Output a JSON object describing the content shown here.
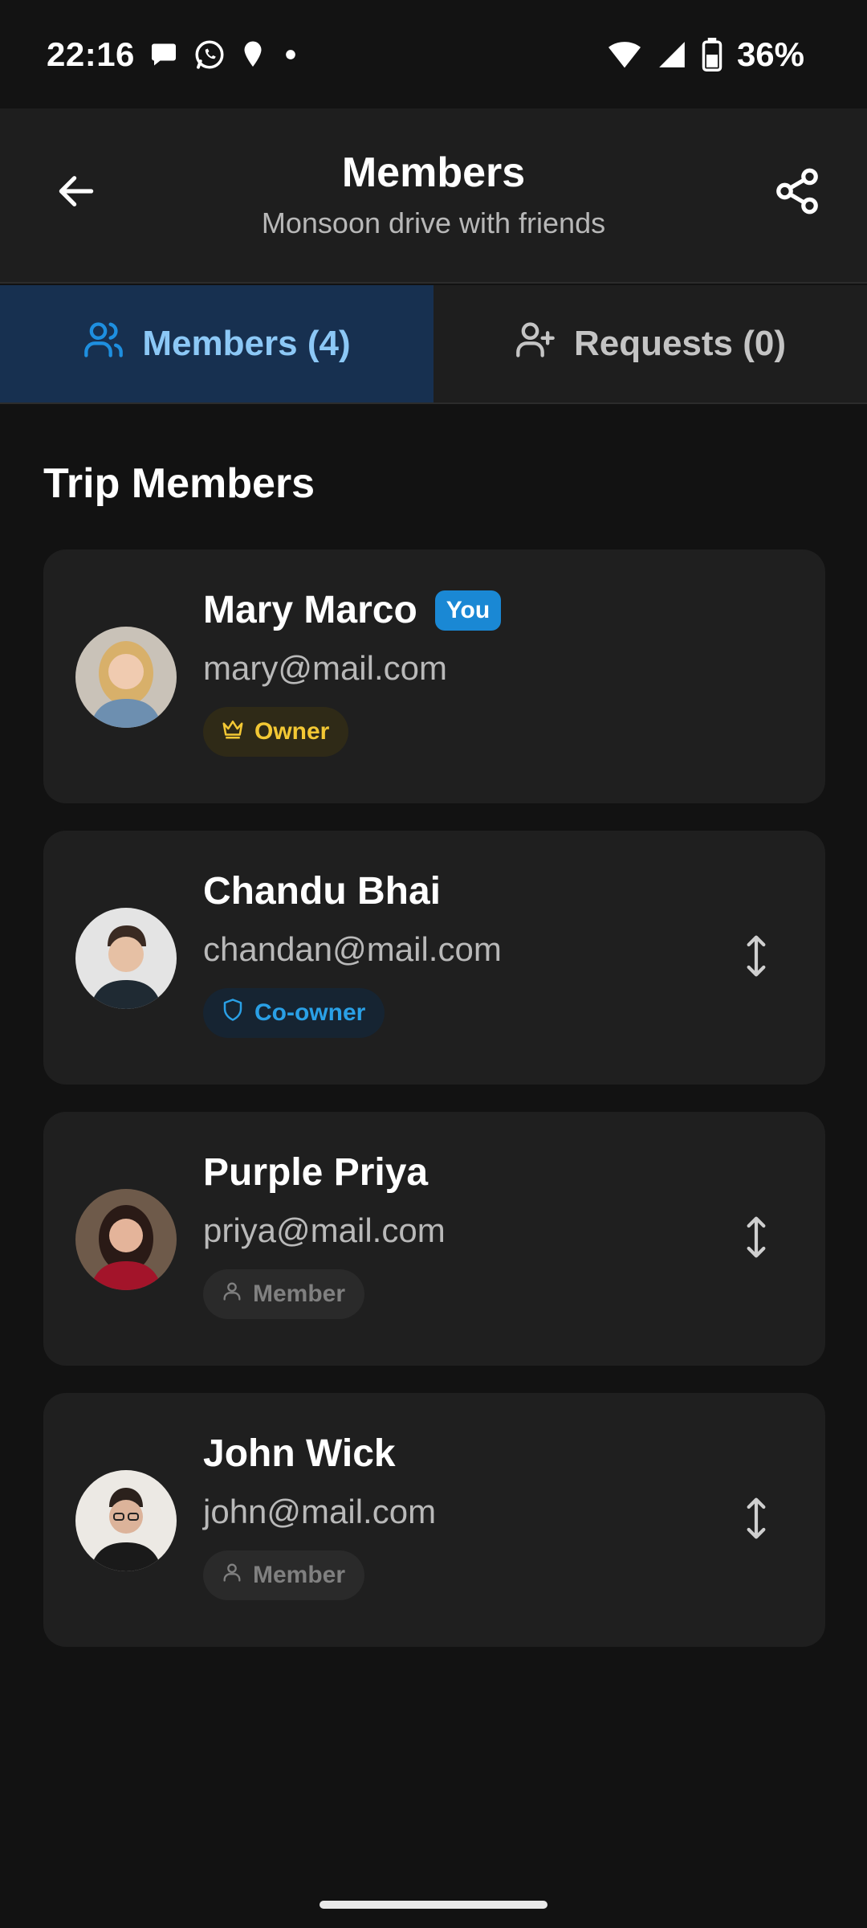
{
  "status_bar": {
    "time": "22:16",
    "battery_percent": "36%",
    "icons": [
      "chat-bubble-icon",
      "whatsapp-icon",
      "location-pin-icon",
      "dot-icon",
      "wifi-icon",
      "signal-icon",
      "battery-icon"
    ]
  },
  "header": {
    "title": "Members",
    "subtitle": "Monsoon drive with friends",
    "back_icon": "arrow-left-icon",
    "share_icon": "share-icon"
  },
  "tabs": [
    {
      "label": "Members (4)",
      "icon": "users-icon",
      "active": true
    },
    {
      "label": "Requests (0)",
      "icon": "user-plus-icon",
      "active": false
    }
  ],
  "section_title": "Trip Members",
  "members": [
    {
      "name": "Mary Marco",
      "email": "mary@mail.com",
      "you_badge": "You",
      "role": "Owner",
      "role_icon": "crown-icon",
      "reorderable": false
    },
    {
      "name": "Chandu Bhai",
      "email": "chandan@mail.com",
      "role": "Co-owner",
      "role_icon": "shield-icon",
      "reorderable": true
    },
    {
      "name": "Purple Priya",
      "email": "priya@mail.com",
      "role": "Member",
      "role_icon": "person-icon",
      "reorderable": true
    },
    {
      "name": "John Wick",
      "email": "john@mail.com",
      "role": "Member",
      "role_icon": "person-icon",
      "reorderable": true
    }
  ],
  "colors": {
    "background": "#121212",
    "card": "#1f1f1f",
    "active_tab_bg": "#173050",
    "active_tab_text": "#8cc8f6",
    "you_badge": "#1a88d4",
    "owner": "#f3c834",
    "coowner": "#2aa0e6",
    "member": "#808080"
  }
}
